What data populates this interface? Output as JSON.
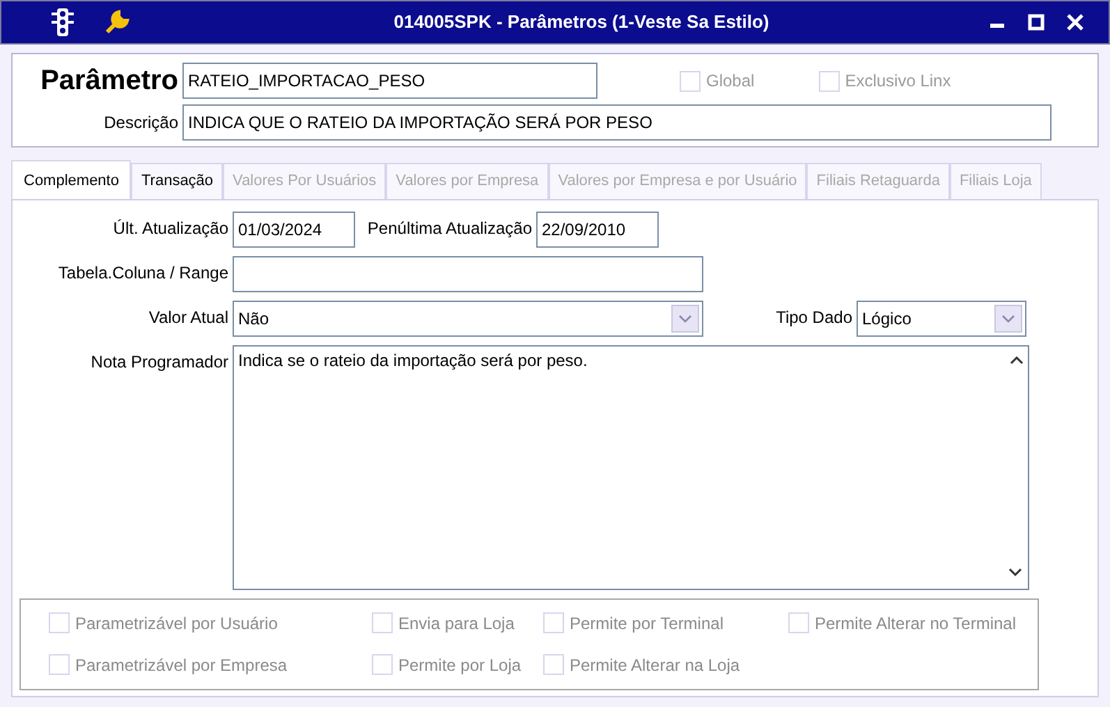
{
  "window": {
    "title": "014005SPK - Parâmetros (1-Veste Sa Estilo)"
  },
  "header": {
    "parametro": {
      "label": "Parâmetro",
      "value": "RATEIO_IMPORTACAO_PESO"
    },
    "flags": [
      {
        "label": "Global",
        "checked": false,
        "disabled": true
      },
      {
        "label": "Exclusivo Linx",
        "checked": false,
        "disabled": true
      }
    ],
    "descricao": {
      "label": "Descrição",
      "value": "INDICA QUE O RATEIO DA IMPORTAÇÃO SERÁ POR PESO"
    }
  },
  "tabs": [
    {
      "label": "Complemento",
      "selected": true,
      "disabled": false
    },
    {
      "label": "Transação",
      "selected": false,
      "disabled": false
    },
    {
      "label": "Valores Por Usuários",
      "selected": false,
      "disabled": true
    },
    {
      "label": "Valores por Empresa",
      "selected": false,
      "disabled": true
    },
    {
      "label": "Valores por Empresa e por Usuário",
      "selected": false,
      "disabled": true
    },
    {
      "label": "Filiais Retaguarda",
      "selected": false,
      "disabled": true
    },
    {
      "label": "Filiais Loja",
      "selected": false,
      "disabled": true
    }
  ],
  "form_rows": [
    [
      {
        "kind": "text",
        "label": "Últ. Atualização",
        "value": "01/03/2024"
      },
      {
        "kind": "text",
        "label": "Penúltima Atualização",
        "value": "22/09/2010"
      }
    ],
    [
      {
        "kind": "text",
        "label": "Tabela.Coluna / Range"
      }
    ],
    [
      {
        "kind": "select",
        "label": "Valor Atual",
        "value": "Não"
      },
      {
        "kind": "select",
        "label": "Tipo Dado",
        "value": "Lógico"
      }
    ],
    [
      {
        "kind": "textarea",
        "label": "Nota Programador",
        "value": "Indica se o rateio da importação será por peso."
      }
    ]
  ],
  "options": [
    {
      "label": "Parametrizável por Usuário",
      "checked": false,
      "disabled": true
    },
    {
      "label": "Envia para Loja",
      "checked": false,
      "disabled": true
    },
    {
      "label": "Permite por Terminal",
      "checked": false,
      "disabled": true
    },
    {
      "label": "Permite Alterar no Terminal",
      "checked": false,
      "disabled": true
    },
    {
      "label": "Parametrizável por Empresa",
      "checked": false,
      "disabled": true
    },
    {
      "label": "Permite por Loja",
      "checked": false,
      "disabled": true
    },
    {
      "label": "Permite Alterar na Loja",
      "checked": false,
      "disabled": true
    }
  ]
}
